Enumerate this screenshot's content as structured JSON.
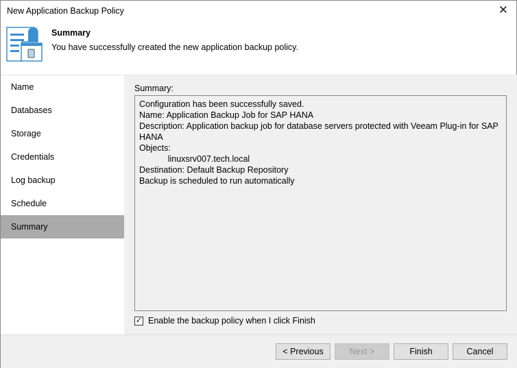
{
  "window": {
    "title": "New Application Backup Policy"
  },
  "header": {
    "title": "Summary",
    "subtitle": "You have successfully created the new application backup policy."
  },
  "nav": {
    "items": [
      "Name",
      "Databases",
      "Storage",
      "Credentials",
      "Log backup",
      "Schedule",
      "Summary"
    ],
    "active": "Summary"
  },
  "main": {
    "summary_label": "Summary:",
    "summary_text": "Configuration has been successfully saved.\nName: Application Backup Job for SAP HANA\nDescription: Application backup job for database servers protected with Veeam Plug-in for SAP HANA\nObjects:\n            linuxsrv007.tech.local\nDestination: Default Backup Repository\nBackup is scheduled to run automatically",
    "enable_checkbox": {
      "label": "Enable the backup policy when I click Finish",
      "checked": true
    }
  },
  "footer": {
    "previous": "< Previous",
    "next": "Next >",
    "finish": "Finish",
    "cancel": "Cancel"
  }
}
